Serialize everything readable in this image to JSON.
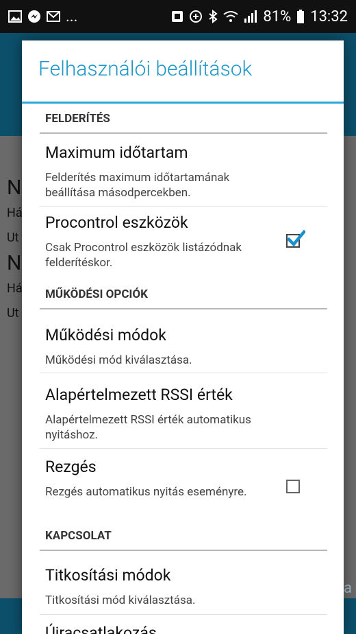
{
  "status_bar": {
    "left_icons": [
      "image-icon",
      "messenger-icon",
      "email-icon"
    ],
    "more": "...",
    "battery": "81%",
    "time": "13:32"
  },
  "background": {
    "rows": [
      {
        "big": "N",
        "small1": "Há",
        "small2": "Ut"
      },
      {
        "big": "N",
        "small1": "Há",
        "small2": "Ut"
      }
    ],
    "right_fragment": "va"
  },
  "dialog": {
    "title": "Felhasználói beállítások",
    "sections": [
      {
        "header": "FELDERÍTÉS",
        "items": [
          {
            "title": "Maximum időtartam",
            "summary": "Felderítés maximum időtartamának beállítása másodpercekben.",
            "checkbox": null
          },
          {
            "title": "Procontrol eszközök",
            "summary": "Csak Procontrol eszközök listázódnak felderítéskor.",
            "checkbox": true
          }
        ]
      },
      {
        "header": "MŰKÖDÉSI OPCIÓK",
        "items": [
          {
            "title": "Működési módok",
            "summary": "Működési mód kiválasztása.",
            "checkbox": null
          },
          {
            "title": "Alapértelmezett RSSI érték",
            "summary": "Alapértelmezett RSSI érték automatikus nyitáshoz.",
            "checkbox": null
          },
          {
            "title": "Rezgés",
            "summary": "Rezgés automatikus nyitás eseményre.",
            "checkbox": false
          }
        ]
      },
      {
        "header": "KAPCSOLAT",
        "items": [
          {
            "title": "Titkosítási módok",
            "summary": "Titkosítási mód kiválasztása.",
            "checkbox": null
          },
          {
            "title": "Újracsatlakozás",
            "summary": "",
            "checkbox": null
          }
        ]
      }
    ]
  },
  "colors": {
    "accent": "#1f96c8",
    "check": "#1a8fd0"
  }
}
